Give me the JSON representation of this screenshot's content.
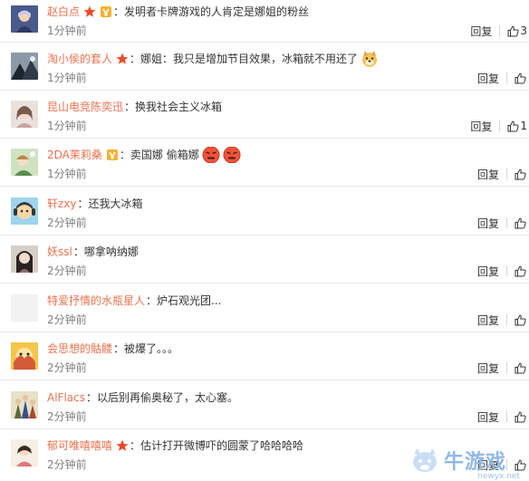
{
  "actions": {
    "reply_label": "回复"
  },
  "comments": [
    {
      "username": "赵白点",
      "content": "发明者卡牌游戏的人肯定是娜姐的粉丝",
      "time": "1分钟前",
      "likes": "3",
      "badges": [
        "star",
        "medal"
      ],
      "emojis": []
    },
    {
      "username": "淘小侯的套人",
      "content": "娜姐：我只是增加节目效果，冰箱就不用还了",
      "time": "1分钟前",
      "likes": "",
      "badges": [
        "star"
      ],
      "emojis": [
        "doge"
      ]
    },
    {
      "username": "昆山电竞陈奕迅",
      "content": "换我社会主义冰箱",
      "time": "1分钟前",
      "likes": "1",
      "badges": [],
      "emojis": []
    },
    {
      "username": "2DA茉莉桑",
      "content": "卖国娜 偷箱娜",
      "time": "1分钟前",
      "likes": "",
      "badges": [
        "medal"
      ],
      "emojis": [
        "angry",
        "angry"
      ]
    },
    {
      "username": "轩zxy",
      "content": "还我大冰箱",
      "time": "2分钟前",
      "likes": "",
      "badges": [],
      "emojis": []
    },
    {
      "username": "妖ssl",
      "content": "哪拿呐纳娜",
      "time": "2分钟前",
      "likes": "",
      "badges": [],
      "emojis": []
    },
    {
      "username": "特爱抒情的水瓶星人",
      "content": "炉石观光团...",
      "time": "2分钟前",
      "likes": "",
      "badges": [],
      "emojis": []
    },
    {
      "username": "会思想的骷髅",
      "content": "被爆了。。。",
      "time": "2分钟前",
      "likes": "",
      "badges": [],
      "emojis": []
    },
    {
      "username": "AlFlacs",
      "content": "以后别再偷奥秘了，太心塞。",
      "time": "2分钟前",
      "likes": "",
      "badges": [],
      "emojis": []
    },
    {
      "username": "郁可唯嘻嘻嘻",
      "content": "估计打开微博吓的圆蒙了哈哈哈哈",
      "time": "2分钟前",
      "likes": "",
      "badges": [
        "star"
      ],
      "emojis": []
    }
  ],
  "watermark": {
    "text": "牛游戏",
    "sub": "newyx.net"
  },
  "colors": {
    "username": "#eb7350",
    "time": "#808080",
    "separator": "#e8e8e8"
  }
}
